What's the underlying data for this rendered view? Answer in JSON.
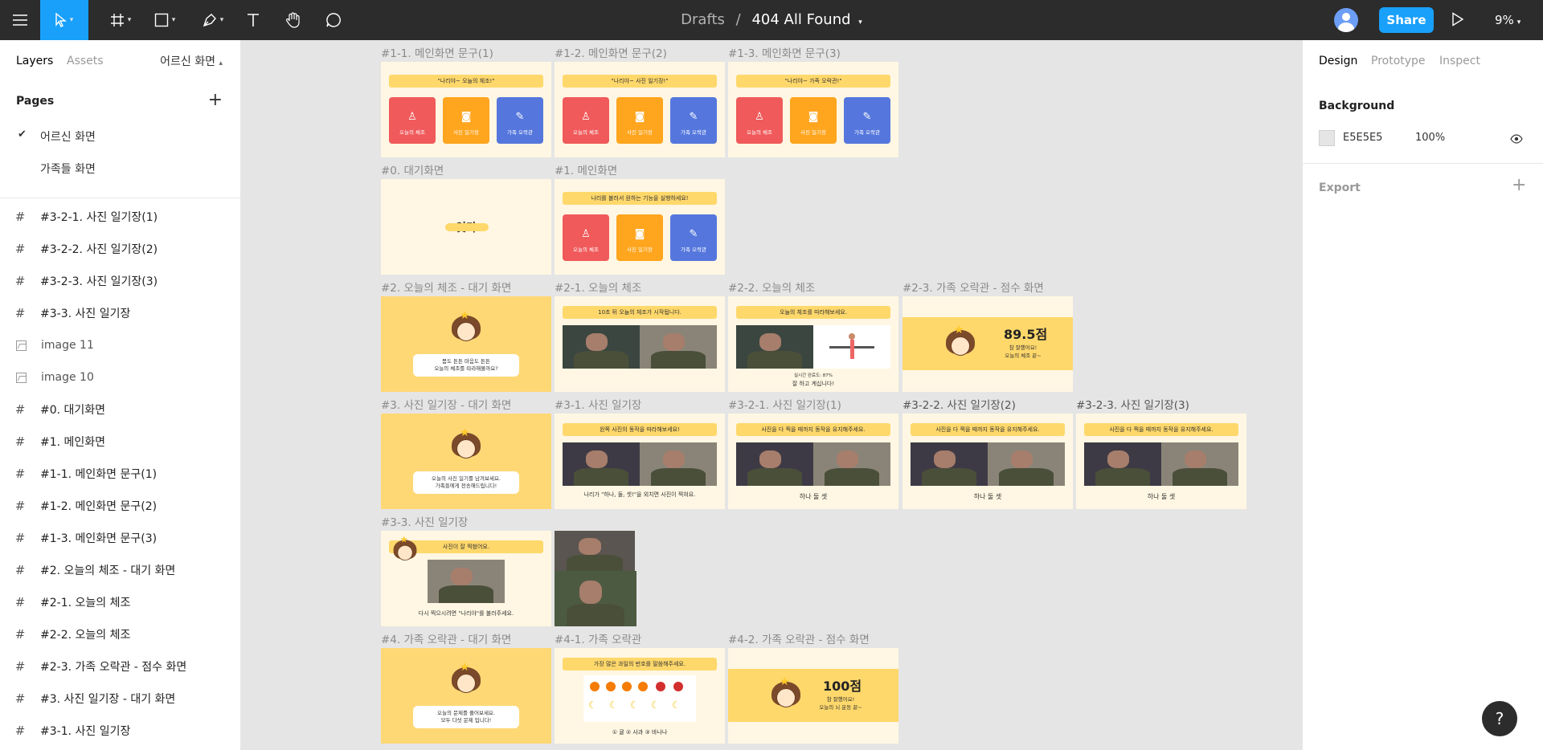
{
  "toolbar": {
    "breadcrumb_root": "Drafts",
    "breadcrumb_sep": "/",
    "file_name": "404 All Found",
    "share_label": "Share",
    "zoom": "9%"
  },
  "left_panel": {
    "tab_layers": "Layers",
    "tab_assets": "Assets",
    "current_page": "어르신 화면",
    "pages_header": "Pages",
    "pages": [
      "어르신 화면",
      "가족들 화면"
    ],
    "layers": [
      {
        "label": "#3-2-1. 사진 일기장(1)",
        "icon": "frame-icon"
      },
      {
        "label": "#3-2-2. 사진 일기장(2)",
        "icon": "frame-icon"
      },
      {
        "label": "#3-2-3. 사진 일기장(3)",
        "icon": "frame-icon"
      },
      {
        "label": "#3-3. 사진 일기장",
        "icon": "frame-icon"
      },
      {
        "label": "image 11",
        "icon": "image-icon"
      },
      {
        "label": "image 10",
        "icon": "image-icon"
      },
      {
        "label": "#0. 대기화면",
        "icon": "frame-icon"
      },
      {
        "label": "#1. 메인화면",
        "icon": "frame-icon"
      },
      {
        "label": "#1-1. 메인화면 문구(1)",
        "icon": "frame-icon"
      },
      {
        "label": "#1-2. 메인화면 문구(2)",
        "icon": "frame-icon"
      },
      {
        "label": "#1-3. 메인화면 문구(3)",
        "icon": "frame-icon"
      },
      {
        "label": "#2. 오늘의 체조 - 대기 화면",
        "icon": "frame-icon"
      },
      {
        "label": "#2-1. 오늘의 체조",
        "icon": "frame-icon"
      },
      {
        "label": "#2-2. 오늘의 체조",
        "icon": "frame-icon"
      },
      {
        "label": "#2-3. 가족 오락관 - 점수 화면",
        "icon": "frame-icon"
      },
      {
        "label": "#3. 사진 일기장 - 대기 화면",
        "icon": "frame-icon"
      },
      {
        "label": "#3-1. 사진 일기장",
        "icon": "frame-icon"
      }
    ]
  },
  "right_panel": {
    "tab_design": "Design",
    "tab_prototype": "Prototype",
    "tab_inspect": "Inspect",
    "background_label": "Background",
    "bg_hex": "E5E5E5",
    "bg_opacity": "100%",
    "bg_color": "#E5E5E5",
    "export_label": "Export"
  },
  "canvas": {
    "frame_labels": {
      "f11": "#1-1. 메인화면 문구(1)",
      "f12": "#1-2. 메인화면 문구(2)",
      "f13": "#1-3. 메인화면 문구(3)",
      "f0": "#0. 대기화면",
      "f1": "#1. 메인화면",
      "f2": "#2. 오늘의 체조 - 대기 화면",
      "f21": "#2-1. 오늘의 체조",
      "f22": "#2-2. 오늘의 체조",
      "f23": "#2-3. 가족 오락관 - 점수 화면",
      "f3": "#3. 사진 일기장 - 대기 화면",
      "f31": "#3-1. 사진 일기장",
      "f321": "#3-2-1. 사진 일기장(1)",
      "f322": "#3-2-2. 사진 일기장(2)",
      "f323": "#3-2-3. 사진 일기장(3)",
      "f33": "#3-3. 사진 일기장",
      "f4": "#4. 가족 오락관 - 대기 화면",
      "f41": "#4-1. 가족 오락관",
      "f42": "#4-2. 가족 오락관 - 점수 화면"
    },
    "tiles": {
      "exercise": "오늘의 체조",
      "photo": "사진 일기장",
      "family": "가족 오락관"
    },
    "bar_11": "\"나리야~ 오늘의 체조!\"",
    "bar_12": "\"나리야~ 사진 일기장!\"",
    "bar_13": "\"나리야~ 가족 오락관!\"",
    "bar_1": "나리를 불러서 원하는 기능을 실행하세요!",
    "splash_text": "잇다",
    "bubble_2": "몸도 튼튼 마음도 튼튼\n오늘의 체조를 따라해볼까요?",
    "bar_21": "10초 뒤 오늘의 체조가 시작됩니다.",
    "bar_22": "오늘의 체조를 따라해보세요.",
    "cap_22a": "실시간 완료도: 87%",
    "cap_22b": "잘 하고 계십니다!",
    "score_23": "89.5점",
    "sub_23": "참 잘했어요!\n오늘의 체조 끝~",
    "bubble_3": "오늘의 사진 일기를 남겨보세요.\n가족들에게 전송해드립니다!",
    "bar_31": "왼쪽 사진의 동작을 따라해보세요!",
    "cap_31": "나리가 \"하나, 둘, 셋!\"을 외치면 사진이 찍혀요.",
    "bar_32": "사진을 다 찍을 때까지 동작을 유지해주세요.",
    "count_321": "하나  둘  셋",
    "count_322": "하나  둘  셋",
    "count_323": "하나  둘  셋",
    "bar_33": "사진이 잘 찍혔어요.",
    "cap_33": "다시 찍으시려면 \"나리야\"를 불러주세요.",
    "bubble_4": "오늘의 문제를 풀어보세요.\n모두 다섯 문제 입니다!",
    "bar_41": "가장 많은 과일의 번호를 말씀해주세요.",
    "cap_41": "① 귤   ② 사과   ③ 바나나",
    "score_42": "100점",
    "sub_42": "참 잘했어요!\n오늘의 뇌 운동 끝~"
  },
  "help_label": "?"
}
